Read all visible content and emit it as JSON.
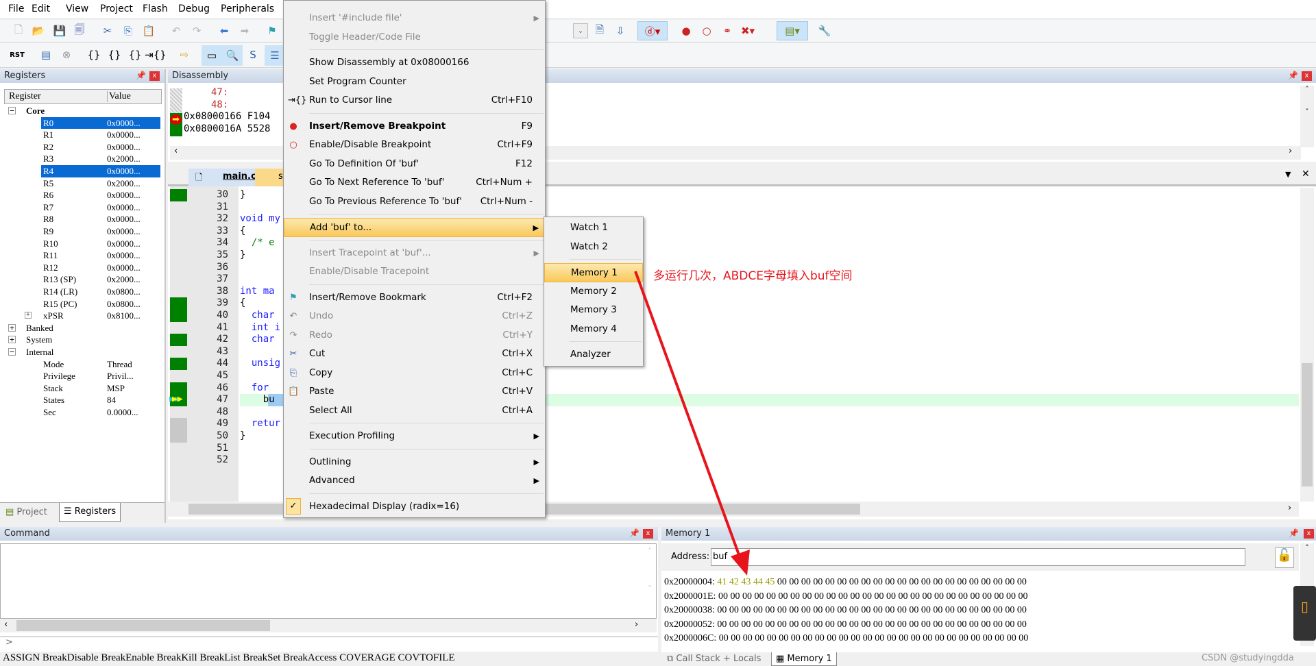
{
  "menubar": [
    "File",
    "Edit",
    "View",
    "Project",
    "Flash",
    "Debug",
    "Peripherals"
  ],
  "registers": {
    "title": "Registers",
    "col_register": "Register",
    "col_value": "Value",
    "groups": {
      "core": "Core",
      "banked": "Banked",
      "system": "System",
      "internal": "Internal"
    },
    "core": [
      [
        "R0",
        "0x0000..."
      ],
      [
        "R1",
        "0x0000..."
      ],
      [
        "R2",
        "0x0000..."
      ],
      [
        "R3",
        "0x2000..."
      ],
      [
        "R4",
        "0x0000..."
      ],
      [
        "R5",
        "0x2000..."
      ],
      [
        "R6",
        "0x0000..."
      ],
      [
        "R7",
        "0x0000..."
      ],
      [
        "R8",
        "0x0000..."
      ],
      [
        "R9",
        "0x0000..."
      ],
      [
        "R10",
        "0x0000..."
      ],
      [
        "R11",
        "0x0000..."
      ],
      [
        "R12",
        "0x0000..."
      ],
      [
        "R13 (SP)",
        "0x2000..."
      ],
      [
        "R14 (LR)",
        "0x0800..."
      ],
      [
        "R15 (PC)",
        "0x0800..."
      ],
      [
        "xPSR",
        "0x8100..."
      ]
    ],
    "internal": [
      [
        "Mode",
        "Thread"
      ],
      [
        "Privilege",
        "Privil..."
      ],
      [
        "Stack",
        "MSP"
      ],
      [
        "States",
        "84"
      ],
      [
        "Sec",
        "0.0000..."
      ]
    ],
    "selected": [
      "R0",
      "R4"
    ],
    "tabs": [
      "Project",
      "Registers"
    ]
  },
  "disassembly": {
    "title": "Disassembly",
    "lines": [
      "47:",
      "48:",
      "0x08000166 F104",
      "0x0800016A 5528"
    ]
  },
  "editor": {
    "tabs": [
      "main.c",
      "s"
    ],
    "lines": [
      [
        "30",
        "}"
      ],
      [
        "31",
        ""
      ],
      [
        "32",
        "void my"
      ],
      [
        "33",
        "{"
      ],
      [
        "34",
        "  /* e"
      ],
      [
        "35",
        "}"
      ],
      [
        "36",
        ""
      ],
      [
        "37",
        ""
      ],
      [
        "38",
        "int ma"
      ],
      [
        "39",
        "{"
      ],
      [
        "40",
        "  char"
      ],
      [
        "41",
        "  int i"
      ],
      [
        "42",
        "  char"
      ],
      [
        "43",
        ""
      ],
      [
        "44",
        "  unsig"
      ],
      [
        "45",
        ""
      ],
      [
        "46",
        "  for"
      ],
      [
        "47",
        "    bu"
      ],
      [
        "48",
        ""
      ],
      [
        "49",
        "  retur"
      ],
      [
        "50",
        "}"
      ],
      [
        "51",
        ""
      ],
      [
        "52",
        ""
      ]
    ],
    "current_line": "47"
  },
  "context_menu": [
    {
      "label": "Insert '#include file'",
      "disabled": true,
      "submenu": true
    },
    {
      "label": "Toggle Header/Code File",
      "disabled": true
    },
    {
      "sep": true
    },
    {
      "label": "Show Disassembly at 0x08000166"
    },
    {
      "label": "Set Program Counter"
    },
    {
      "label": "Run to Cursor line",
      "key": "Ctrl+F10",
      "icon": "run-to-cursor"
    },
    {
      "sep": true
    },
    {
      "label": "Insert/Remove Breakpoint",
      "key": "F9",
      "icon": "breakpoint",
      "bold": true
    },
    {
      "label": "Enable/Disable Breakpoint",
      "key": "Ctrl+F9",
      "icon": "breakpoint-outline"
    },
    {
      "label": "Go To Definition Of 'buf'",
      "key": "F12"
    },
    {
      "label": "Go To Next Reference To 'buf'",
      "key": "Ctrl+Num +"
    },
    {
      "label": "Go To Previous Reference To 'buf'",
      "key": "Ctrl+Num -"
    },
    {
      "sep": true
    },
    {
      "label": "Add 'buf' to...",
      "submenu": true,
      "highlighted": true
    },
    {
      "sep": true
    },
    {
      "label": "Insert Tracepoint at 'buf'...",
      "disabled": true,
      "submenu": true
    },
    {
      "label": "Enable/Disable Tracepoint",
      "disabled": true
    },
    {
      "sep": true
    },
    {
      "label": "Insert/Remove Bookmark",
      "key": "Ctrl+F2",
      "icon": "bookmark"
    },
    {
      "label": "Undo",
      "key": "Ctrl+Z",
      "icon": "undo",
      "disabled": true
    },
    {
      "label": "Redo",
      "key": "Ctrl+Y",
      "icon": "redo",
      "disabled": true
    },
    {
      "label": "Cut",
      "key": "Ctrl+X",
      "icon": "cut"
    },
    {
      "label": "Copy",
      "key": "Ctrl+C",
      "icon": "copy"
    },
    {
      "label": "Paste",
      "key": "Ctrl+V",
      "icon": "paste"
    },
    {
      "label": "Select All",
      "key": "Ctrl+A"
    },
    {
      "sep": true
    },
    {
      "label": "Execution Profiling",
      "submenu": true
    },
    {
      "sep": true
    },
    {
      "label": "Outlining",
      "submenu": true
    },
    {
      "label": "Advanced",
      "submenu": true
    },
    {
      "sep": true
    },
    {
      "label": "Hexadecimal Display (radix=16)",
      "icon": "check",
      "checked": true
    }
  ],
  "submenu": [
    {
      "label": "Watch 1"
    },
    {
      "label": "Watch 2"
    },
    {
      "sep": true
    },
    {
      "label": "Memory 1",
      "highlighted": true
    },
    {
      "label": "Memory 2"
    },
    {
      "label": "Memory 3"
    },
    {
      "label": "Memory 4"
    },
    {
      "sep": true
    },
    {
      "label": "Analyzer"
    }
  ],
  "annotation": {
    "text": "多运行几次，ABDCE字母填入buf空间",
    "color": "#e8141c"
  },
  "command": {
    "title": "Command",
    "prompt": ">",
    "hints": "ASSIGN BreakDisable BreakEnable BreakKill BreakList BreakSet BreakAccess COVERAGE COVTOFILE"
  },
  "memory": {
    "title": "Memory 1",
    "address_label": "Address:",
    "address_value": "buf",
    "rows": [
      [
        "0x20000004:",
        "41 42 43 44 45",
        "00 00 00 00 00 00 00 00 00 00 00 00 00 00 00 00 00 00 00 00 00"
      ],
      [
        "0x2000001E:",
        "",
        "00 00 00 00 00 00 00 00 00 00 00 00 00 00 00 00 00 00 00 00 00 00 00 00 00 00"
      ],
      [
        "0x20000038:",
        "",
        "00 00 00 00 00 00 00 00 00 00 00 00 00 00 00 00 00 00 00 00 00 00 00 00 00 00"
      ],
      [
        "0x20000052:",
        "",
        "00 00 00 00 00 00 00 00 00 00 00 00 00 00 00 00 00 00 00 00 00 00 00 00 00 00"
      ],
      [
        "0x2000006C:",
        "",
        "00 00 00 00 00 00 00 00 00 00 00 00 00 00 00 00 00 00 00 00 00 00 00 00 00 00"
      ]
    ],
    "changed_color": "#9a9a00",
    "tabs": [
      "Call Stack + Locals",
      "Memory 1"
    ]
  },
  "watermark": "CSDN @studyingdda",
  "colors": {
    "accent_select": "#0a6ad4",
    "menu_highlight": "#f9c85a",
    "exec_green": "#008000"
  }
}
